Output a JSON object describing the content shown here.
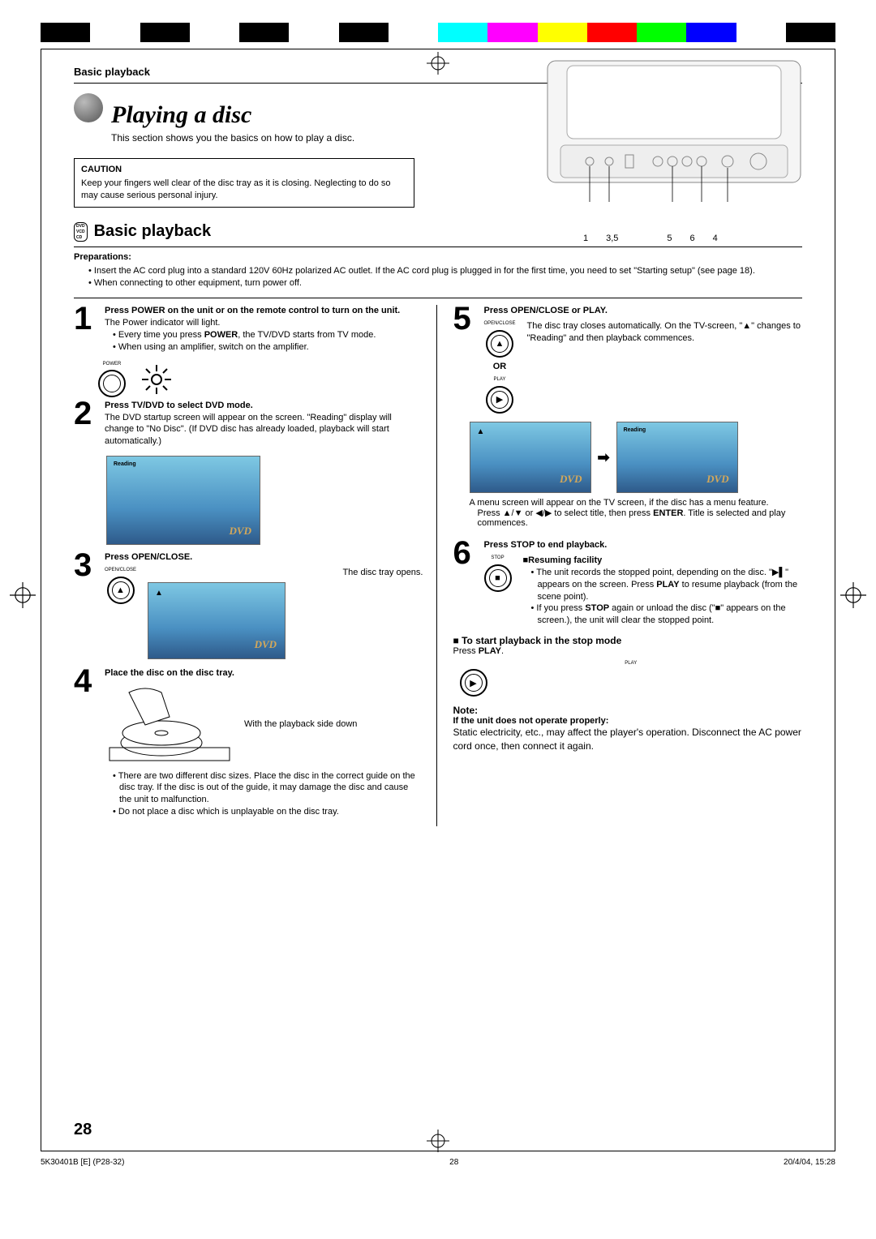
{
  "header": {
    "section": "Basic playback"
  },
  "title": "Playing a disc",
  "intro": "This section shows you the basics on how to play a disc.",
  "caution": {
    "heading": "CAUTION",
    "body": "Keep your fingers well clear of the disc tray as it is closing. Neglecting to do so may cause serious personal injury."
  },
  "device_callouts": [
    "1",
    "3,5",
    "5",
    "6",
    "4"
  ],
  "disc_labels": [
    "DVD",
    "VCD",
    "CD"
  ],
  "section_heading": "Basic playback",
  "preparations": {
    "heading": "Preparations:",
    "items": [
      "Insert the AC cord plug into a standard 120V 60Hz polarized AC outlet. If the AC cord plug is plugged in for the first time, you need to set \"Starting setup\" (see page 18).",
      "When connecting to other equipment, turn power off."
    ]
  },
  "steps": {
    "s1": {
      "num": "1",
      "lead": "Press POWER on the unit or on the remote control to turn on the unit.",
      "line1": "The Power indicator will light.",
      "b1": "Every time you press POWER, the TV/DVD starts from TV mode.",
      "b1_bold": "POWER",
      "b2": "When using an amplifier, switch on the amplifier.",
      "btn": "POWER"
    },
    "s2": {
      "num": "2",
      "lead": "Press TV/DVD to select DVD mode.",
      "body": "The DVD startup screen will appear on the screen. \"Reading\" display will change to \"No Disc\". (If DVD disc has already loaded, playback will start automatically.)",
      "thumb_label": "Reading",
      "thumb_logo": "DVD"
    },
    "s3": {
      "num": "3",
      "lead": "Press OPEN/CLOSE.",
      "line1": "The disc tray opens.",
      "btn": "OPEN/CLOSE",
      "thumb_logo": "DVD"
    },
    "s4": {
      "num": "4",
      "lead": "Place the disc on the disc tray.",
      "caption": "With the playback side down",
      "b1": "There are two different disc sizes. Place the disc in the correct guide on the disc tray. If the disc is out of the guide, it may damage the disc and cause the unit to malfunction.",
      "b2": "Do not place a disc which is unplayable on the disc tray."
    },
    "s5": {
      "num": "5",
      "lead": "Press OPEN/CLOSE or PLAY.",
      "btn1": "OPEN/CLOSE",
      "or": "OR",
      "btn2": "PLAY",
      "body": "The disc tray closes automatically. On the TV-screen, \"▲\" changes to \"Reading\" and then playback commences.",
      "thumb1_label": "Reading",
      "thumb_logo": "DVD",
      "after1": "A menu screen will appear on the TV screen, if the disc has a menu feature.",
      "after2_a": "Press ▲/▼ or ◀/▶ to select title, then press ",
      "after2_bold": "ENTER",
      "after2_b": ". Title is selected and play commences."
    },
    "s6": {
      "num": "6",
      "lead": "Press STOP to end playback.",
      "btn": "STOP",
      "resume_h": "Resuming facility",
      "r1a": "The unit records the stopped point, depending on the disc. \"▶▌\" appears on the screen. Press ",
      "r1bold": "PLAY",
      "r1b": " to resume playback (from the scene point).",
      "r2a": "If you press ",
      "r2bold": "STOP",
      "r2b": " again or unload the disc (\"■\" appears on the screen.), the unit will clear the stopped point."
    }
  },
  "start_stop": {
    "heading": "To start playback in the stop mode",
    "body_a": "Press ",
    "body_bold": "PLAY",
    "body_b": ".",
    "btn": "PLAY"
  },
  "note": {
    "heading": "Note:",
    "sub": "If the unit does not operate properly:",
    "body": "Static electricity, etc., may affect the player's operation. Disconnect the AC power cord once, then connect it again."
  },
  "page_number": "28",
  "footer": {
    "left": "5K30401B [E] (P28-32)",
    "center": "28",
    "right": "20/4/04, 15:28"
  },
  "colors": [
    "#000",
    "#fff",
    "#000",
    "#fff",
    "#000",
    "#fff",
    "#000",
    "#fff",
    "#0ff",
    "#f0f",
    "#ff0",
    "#f00",
    "#0f0",
    "#00f",
    "#fff",
    "#000"
  ]
}
